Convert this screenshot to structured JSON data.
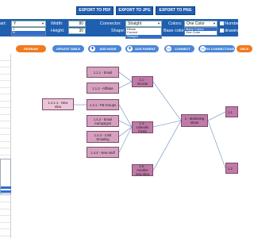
{
  "export": {
    "pdf": "EXPORT TO PDF",
    "jpg": "EXPORT TO JPG",
    "png": "EXPORT TO PNG"
  },
  "settings": {
    "start_label": "art:",
    "start_value": "Y",
    "width_label": "Width:",
    "width_value": "80",
    "height_label": "Height:",
    "height_value": "30",
    "connector_label": "Connector:",
    "connector_value": "Straight",
    "shape_label": "Shape:",
    "colors_label": "Colors:",
    "colors_value": "One Color",
    "base_color_label": "Base color:",
    "numbering_label": "Numbering",
    "drawing_label": "drawing",
    "start_options": [
      "Y",
      "N"
    ],
    "connector_options": [
      "Elbow",
      "Curved",
      "Straight"
    ],
    "colors_options": [
      "Many Colors",
      "One Color"
    ]
  },
  "toolbar": {
    "redraw": "REDRAW",
    "update_table": "UPDATE TABLE",
    "add_node": "ADD NODE",
    "add_parent": "ADD PARENT",
    "connect": "CONNECT",
    "fix_connections": "FIX CONNECTIONS",
    "delete": "DELE"
  },
  "nodes": {
    "n111": "1.1.1 - Email",
    "n112": "1.1.2 - Affiliate",
    "n141": "1.4.1 - FB Groups",
    "n142": "1.4.2 - Email Campaigns",
    "n143": "1.4.3 - Cold Emailing",
    "n144": "1.4.4 - New stuff",
    "n1411": "1.4.1.1 - New Idea",
    "n11": "1.1 - Income",
    "n14": "1.4 - Linkedin Posts",
    "n15": "1.5 - Another new Idea",
    "root": "1 - Marketing Ideas",
    "r1": "1.1",
    "r2": "1.2"
  }
}
